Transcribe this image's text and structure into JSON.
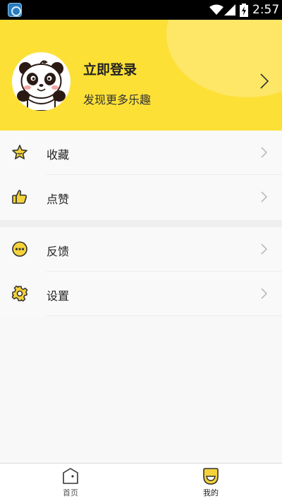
{
  "status_bar": {
    "time": "2:57"
  },
  "profile": {
    "title": "立即登录",
    "subtitle": "发现更多乐趣"
  },
  "menu_groups": [
    {
      "items": [
        {
          "label": "收藏",
          "icon": "star-icon"
        },
        {
          "label": "点赞",
          "icon": "thumbs-up-icon"
        }
      ]
    },
    {
      "items": [
        {
          "label": "反馈",
          "icon": "feedback-dots-icon"
        },
        {
          "label": "设置",
          "icon": "gear-icon"
        }
      ]
    }
  ],
  "tabs": [
    {
      "label": "首页",
      "icon": "home-icon"
    },
    {
      "label": "我的",
      "icon": "smile-face-icon",
      "active": true
    }
  ],
  "colors": {
    "accent": "#fde036",
    "icon_fill": "#f5d23a",
    "icon_stroke": "#333333"
  }
}
